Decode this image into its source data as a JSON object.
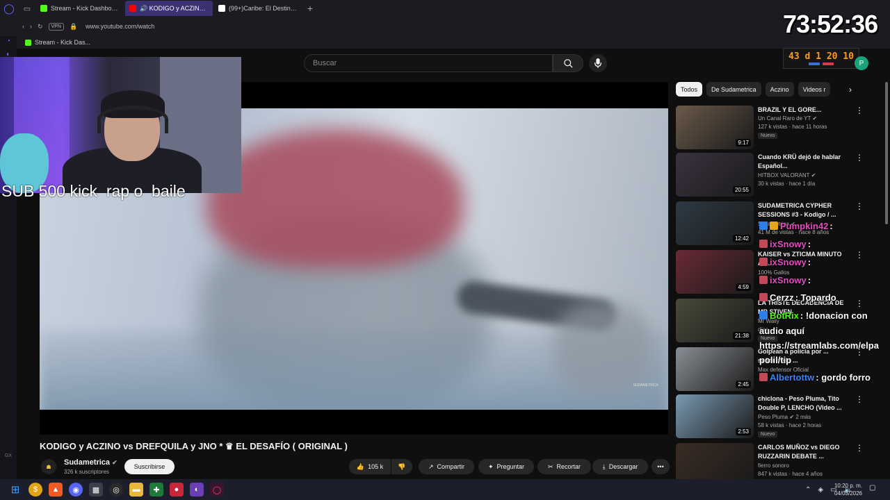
{
  "browser": {
    "tabs": [
      {
        "label": "Stream - Kick Dashboard",
        "active": false,
        "favicon_color": "#53fc18"
      },
      {
        "label": "KODIGO y ACZINO vs",
        "active": true,
        "favicon_color": "#ff0000"
      },
      {
        "label": "(99+)Caribe: El Destino Pe",
        "active": false,
        "favicon_color": "#ffffff"
      }
    ],
    "vpn_label": "VPN",
    "url": "www.youtube.com/watch",
    "bookmark": "Stream - Kick Das..."
  },
  "left_rail": {
    "gx_label": "GX"
  },
  "youtube": {
    "search_placeholder": "Buscar",
    "video_watermark": "SUDAMETRICA",
    "video_title": "KODIGO y ACZINO vs DREFQUILA y JNO * ♛ EL DESAFÍO ( ORIGINAL )",
    "channel": {
      "name": "Sudametrica",
      "verified": true,
      "subscribers": "326 k suscriptores",
      "avatar_letter": "☗"
    },
    "subscribe_label": "Suscribirse",
    "actions": {
      "like_count": "105 k",
      "share": "Compartir",
      "ask": "Preguntar",
      "clip": "Recortar",
      "download": "Descargar"
    },
    "chips": [
      "Todos",
      "De Sudametrica",
      "Aczino",
      "Videos r"
    ],
    "recommendations": [
      {
        "title": "BRAZIL Y EL GORE...",
        "channel": "Un Canal Raro de YT",
        "verified": true,
        "stats": "127 k vistas · hace 11 horas",
        "badge": "Nuevo",
        "duration": "9:17",
        "thumb": "#6b5a4a"
      },
      {
        "title": "Cuando KRÜ dejó de hablar Español...",
        "channel": "HITBOX VALORANT",
        "verified": true,
        "stats": "30 k vistas · hace 1 día",
        "badge": "",
        "duration": "20:55",
        "thumb": "#3a3340"
      },
      {
        "title": "SUDAMETRICA CYPHER SESSIONS #3 - Kodigo / ...",
        "channel": "Sudametrica",
        "verified": true,
        "stats": "41 M de vistas · hace 8 años",
        "badge": "",
        "duration": "12:42",
        "thumb": "#2e3a44"
      },
      {
        "title": "KAISER vs ZTICMA MINUTO A S...",
        "channel": "100% Gallos",
        "verified": false,
        "stats": "",
        "badge": "",
        "duration": "4:59",
        "thumb": "#6a2a34"
      },
      {
        "title": "LA TRISTE DECADENCIA DE MR STIVEN",
        "channel": "Mr Wally",
        "verified": false,
        "stats": "días",
        "badge": "Nuevo",
        "duration": "21:38",
        "thumb": "#4a4b3a"
      },
      {
        "title": "Golpean a policía por ... señor de la ...",
        "channel": "Max defensor Oficial",
        "verified": false,
        "stats": "",
        "badge": "",
        "duration": "2:45",
        "thumb": "#8a8f95"
      },
      {
        "title": "chiclona - Peso Pluma, Tito Double P, LENCHO (Video ...",
        "channel": "Peso Pluma",
        "verified": true,
        "stats": "58 k vistas · hace 2 horas",
        "badge": "Nuevo",
        "channel_extra": "2 más",
        "duration": "2:53",
        "thumb": "#7a9ab2"
      },
      {
        "title": "CARLOS MUÑOZ vs DIEGO RUZZARIN DEBATE ...",
        "channel": "fierro sonoro",
        "verified": false,
        "stats": "847 k vistas · hace 4 años",
        "badge": "",
        "duration": "",
        "thumb": "#3a2c24"
      }
    ]
  },
  "overlays": {
    "sub_text": "SUB 500 kick  rap o  baile",
    "timer": "73:52:36",
    "counter": "43 d 1 20 10",
    "profile_letter": "P",
    "chat": [
      {
        "user": "Pumpkin42",
        "text": ":",
        "color": "#e44cc0",
        "icon_colors": [
          "#2f7ee6",
          "#e6a81a"
        ]
      },
      {
        "user": "ixSnowy",
        "text": ":",
        "color": "#e44cc0",
        "icon_colors": [
          "#c2485a"
        ]
      },
      {
        "user": "ixSnowy",
        "text": ":",
        "color": "#e44cc0",
        "icon_colors": [
          "#c2485a"
        ]
      },
      {
        "user": "ixSnowy",
        "text": ":",
        "color": "#e44cc0",
        "icon_colors": [
          "#c2485a"
        ]
      },
      {
        "user": "Cerzz",
        "text": ": Topardo",
        "color": "#ffffff",
        "icon_colors": [
          "#c2485a"
        ]
      },
      {
        "user": "BotRix",
        "text": ": !donacion con",
        "color": "#53fc18",
        "icon_colors": [
          "#2f7ee6"
        ]
      },
      {
        "user": "",
        "text": "audio aquí",
        "color": "#ffffff",
        "icon_colors": []
      },
      {
        "user": "",
        "text": "https://streamlabs.com/elpa",
        "color": "#ffffff",
        "icon_colors": []
      },
      {
        "user": "",
        "text": "polil/tip",
        "color": "#ffffff",
        "icon_colors": []
      },
      {
        "user": "Albertottw",
        "text": ": gordo forro",
        "color": "#3b82f6",
        "icon_colors": [
          "#c2485a"
        ]
      }
    ]
  },
  "taskbar": {
    "time": "10:20 p. m.",
    "date": "04/03/2026"
  }
}
